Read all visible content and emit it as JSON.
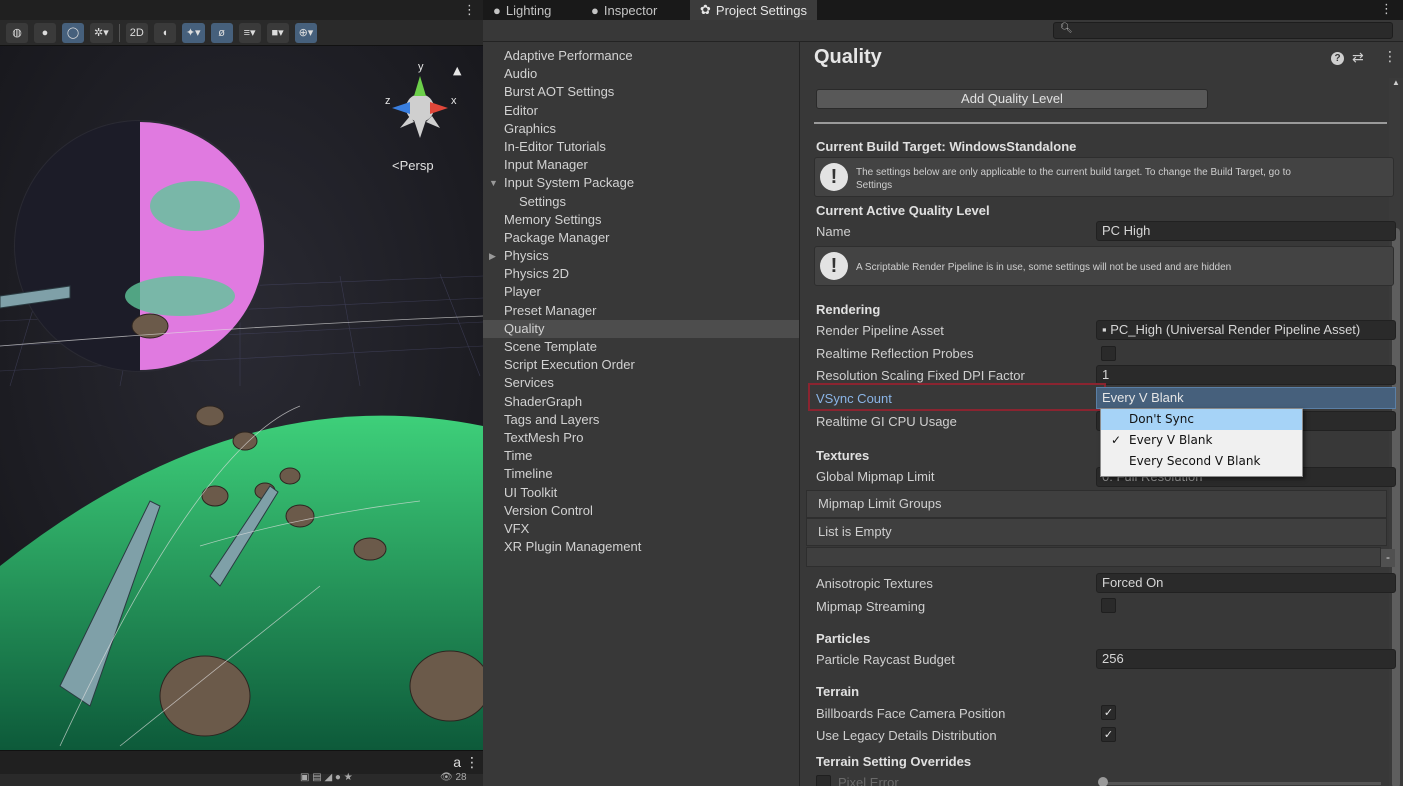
{
  "tabs": [
    {
      "label": "Lighting",
      "icon": "lightbulb-icon"
    },
    {
      "label": "Inspector",
      "icon": "info-icon"
    },
    {
      "label": "Project Settings",
      "icon": "gear-icon"
    }
  ],
  "scene": {
    "toolbar_2d_label": "2D",
    "persp_label": "Persp",
    "gizmo_x": "x",
    "gizmo_y": "y",
    "gizmo_z": "z",
    "visible_count": "28"
  },
  "sidebar": {
    "items": [
      {
        "label": "Adaptive Performance"
      },
      {
        "label": "Audio"
      },
      {
        "label": "Burst AOT Settings"
      },
      {
        "label": "Editor"
      },
      {
        "label": "Graphics"
      },
      {
        "label": "In-Editor Tutorials"
      },
      {
        "label": "Input Manager"
      },
      {
        "label": "Input System Package"
      },
      {
        "label": "Settings"
      },
      {
        "label": "Memory Settings"
      },
      {
        "label": "Package Manager"
      },
      {
        "label": "Physics"
      },
      {
        "label": "Physics 2D"
      },
      {
        "label": "Player"
      },
      {
        "label": "Preset Manager"
      },
      {
        "label": "Quality"
      },
      {
        "label": "Scene Template"
      },
      {
        "label": "Script Execution Order"
      },
      {
        "label": "Services"
      },
      {
        "label": "ShaderGraph"
      },
      {
        "label": "Tags and Layers"
      },
      {
        "label": "TextMesh Pro"
      },
      {
        "label": "Time"
      },
      {
        "label": "Timeline"
      },
      {
        "label": "UI Toolkit"
      },
      {
        "label": "Version Control"
      },
      {
        "label": "VFX"
      },
      {
        "label": "XR Plugin Management"
      }
    ]
  },
  "quality": {
    "title": "Quality",
    "add_button": "Add Quality Level",
    "build_target_heading": "Current Build Target: WindowsStandalone",
    "build_target_help_line1": "The settings below are only applicable to the current build target. To change the Build Target, go to",
    "build_target_help_line2": "Settings",
    "active_level_heading": "Current Active Quality Level",
    "name_label": "Name",
    "name_value": "PC High",
    "srp_help": "A Scriptable Render Pipeline is in use, some settings will not be used and are hidden",
    "rendering": {
      "heading": "Rendering",
      "rpa_label": "Render Pipeline Asset",
      "rpa_value": "PC_High (Universal Render Pipeline Asset)",
      "rrp_label": "Realtime Reflection Probes",
      "rsdpi_label": "Resolution Scaling Fixed DPI Factor",
      "rsdpi_value": "1",
      "vsync_label": "VSync Count",
      "vsync_value": "Every V Blank",
      "rtgi_label": "Realtime GI CPU Usage"
    },
    "vsync_options": [
      "Don't Sync",
      "Every V Blank",
      "Every Second V Blank"
    ],
    "vsync_selected": "Every V Blank",
    "textures": {
      "heading": "Textures",
      "gml_label": "Global Mipmap Limit",
      "gml_value": "0: Full Resolution",
      "mlg_label": "Mipmap Limit Groups",
      "list_empty": "List is Empty",
      "aniso_label": "Anisotropic Textures",
      "aniso_value": "Forced On",
      "mipstream_label": "Mipmap Streaming"
    },
    "particles": {
      "heading": "Particles",
      "raycast_label": "Particle Raycast Budget",
      "raycast_value": "256"
    },
    "terrain": {
      "heading": "Terrain",
      "billboards_label": "Billboards Face Camera Position",
      "legacy_label": "Use Legacy Details Distribution",
      "overrides_heading": "Terrain Setting Overrides",
      "pixel_error_label": "Pixel Error"
    }
  }
}
